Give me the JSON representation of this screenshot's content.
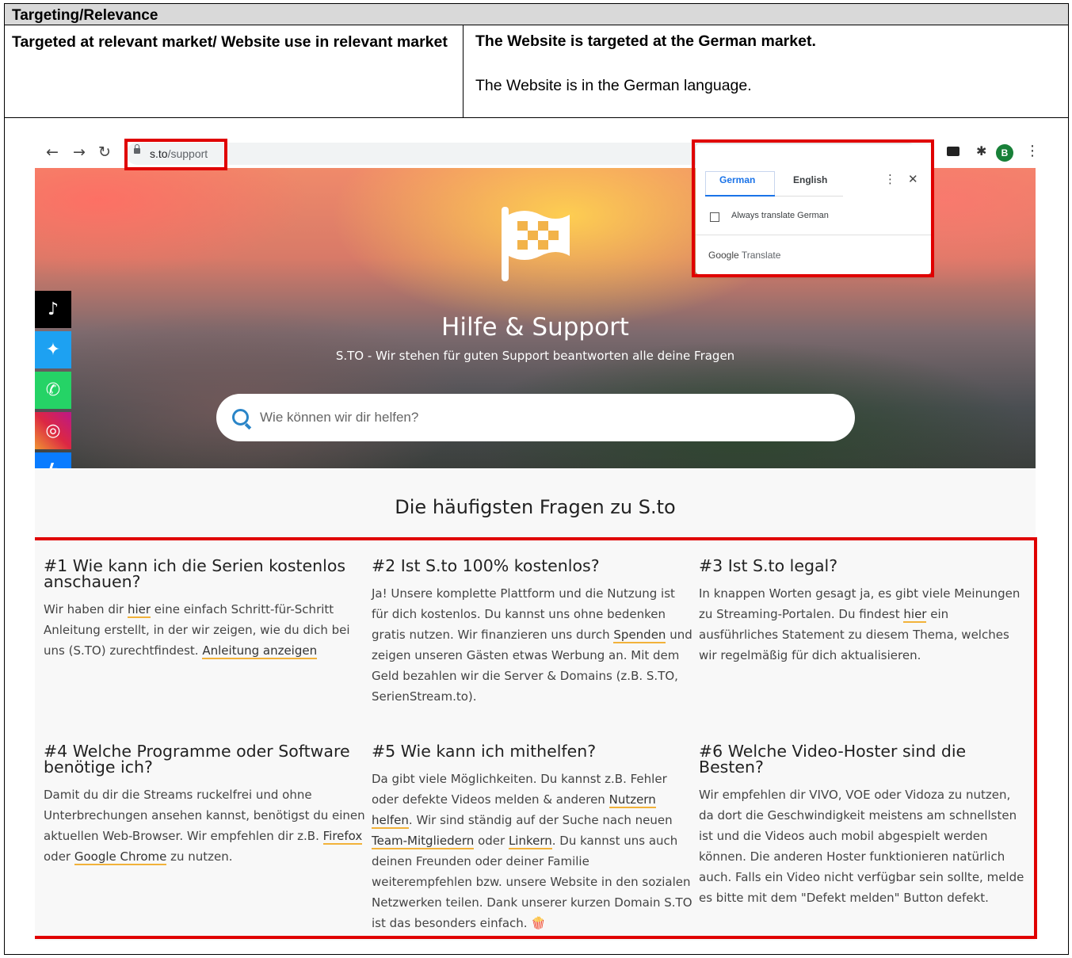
{
  "doc": {
    "section_title": "Targeting/Relevance",
    "row_label": "Targeted at relevant market/ Website use in relevant market",
    "finding_1": "The Website is targeted at the German market.",
    "finding_2": "The Website is in the German language."
  },
  "browser": {
    "url_host": "s.to",
    "url_path": "/support",
    "avatar_letter": "B",
    "translate_popup": {
      "tab_source": "German",
      "tab_target": "English",
      "always_translate": "Always translate German",
      "brand": "Google",
      "brand_suffix": "Translate"
    }
  },
  "site": {
    "hero_title": "Hilfe & Support",
    "hero_subtitle": "S.TO - Wir stehen für guten Support beantworten alle deine Fragen",
    "search_placeholder": "Wie können wir dir helfen?",
    "faq_heading": "Die häufigsten Fragen zu S.to",
    "social": [
      "tiktok-icon",
      "twitter-icon",
      "whatsapp-icon",
      "instagram-icon",
      "messenger-icon",
      "telegram-icon"
    ],
    "faq": [
      {
        "title": "#1 Wie kann ich die Serien kostenlos anschauen?",
        "t1": "Wir haben dir ",
        "l1": "hier",
        "t2": " eine einfach Schritt-für-Schritt Anleitung erstellt, in der wir zeigen, wie du dich bei uns (S.TO) zurechtfindest. ",
        "l2": "Anleitung anzeigen"
      },
      {
        "title": "#2 Ist S.to 100% kostenlos?",
        "t1": "Ja! Unsere komplette Plattform und die Nutzung ist für dich kostenlos. Du kannst uns ohne bedenken gratis nutzen. Wir finanzieren uns durch ",
        "l1": "Spenden",
        "t2": " und zeigen unseren Gästen etwas Werbung an. Mit dem Geld bezahlen wir die Server & Domains (z.B. S.TO, SerienStream.to)."
      },
      {
        "title": "#3 Ist S.to legal?",
        "t1": "In knappen Worten gesagt ja, es gibt viele Meinungen zu Streaming-Portalen. Du findest ",
        "l1": "hier",
        "t2": " ein ausführliches Statement zu diesem Thema, welches wir regelmäßig für dich aktualisieren."
      },
      {
        "title": "#4 Welche Programme oder Software benötige ich?",
        "t1": "Damit du dir die Streams ruckelfrei und ohne Unterbrechungen ansehen kannst, benötigst du einen aktuellen Web-Browser. Wir empfehlen dir z.B. ",
        "l1": "Firefox",
        "t2": " oder ",
        "l2": "Google Chrome",
        "t3": " zu nutzen."
      },
      {
        "title": "#5 Wie kann ich mithelfen?",
        "t1": "Da gibt viele Möglichkeiten. Du kannst z.B. Fehler oder defekte Videos melden & anderen ",
        "l1": "Nutzern helfen",
        "t2": ". Wir sind ständig auf der Suche nach neuen ",
        "l2": "Team-Mitgliedern",
        "t3": " oder ",
        "l3": "Linkern",
        "t4": ". Du kannst uns auch deinen Freunden oder deiner Familie weiterempfehlen bzw. unsere Website in den sozialen Netzwerken teilen. Dank unserer kurzen Domain S.TO ist das besonders einfach. ",
        "emoji": "🍿"
      },
      {
        "title": "#6 Welche Video-Hoster sind die Besten?",
        "t1": "Wir empfehlen dir VIVO, VOE oder Vidoza zu nutzen, da dort die Geschwindigkeit meistens am schnellsten ist und die Videos auch mobil abgespielt werden können. Die anderen Hoster funktionieren natürlich auch. Falls ein Video nicht verfügbar sein sollte, melde es bitte mit dem \"Defekt melden\" Button defekt."
      }
    ]
  },
  "colors": {
    "highlight_box": "#e00000",
    "link_underline": "#f2b23a",
    "search_icon": "#2a85c8"
  }
}
